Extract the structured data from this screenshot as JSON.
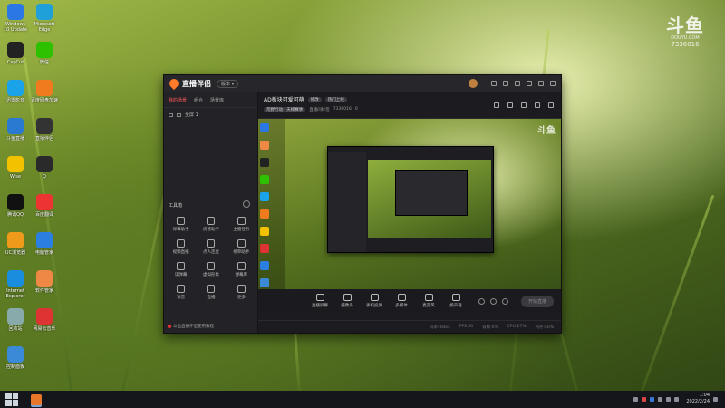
{
  "watermark": {
    "logo": "斗鱼",
    "sub": "DOUYU.COM",
    "room_no": "7336016"
  },
  "desktop_icons": [
    {
      "label": "Windows 10 Update",
      "color": "#2b78e4"
    },
    {
      "label": "Microsoft Edge",
      "color": "#1fa0d8"
    },
    {
      "label": "CapCut",
      "color": "#222"
    },
    {
      "label": "微信",
      "color": "#2dc100"
    },
    {
      "label": "迅雷影音",
      "color": "#1aa3e8"
    },
    {
      "label": "百度网盘加速",
      "color": "#f07b1e"
    },
    {
      "label": "斗鱼直播",
      "color": "#2a7ad1"
    },
    {
      "label": "直播伴侣",
      "color": "#333"
    },
    {
      "label": "Wise",
      "color": "#f2c200"
    },
    {
      "label": "Q",
      "color": "#2a2a2a"
    },
    {
      "label": "腾讯QQ",
      "color": "#111"
    },
    {
      "label": "百度翻译",
      "color": "#e33"
    },
    {
      "label": "UC浏览器",
      "color": "#f09a1c"
    },
    {
      "label": "电脑管家",
      "color": "#2a7fe0"
    },
    {
      "label": "Internet Explorer",
      "color": "#1a8ddf"
    },
    {
      "label": "软件管家",
      "color": "#e84"
    },
    {
      "label": "回收站",
      "color": "#8aa"
    },
    {
      "label": "网易云音乐",
      "color": "#d33"
    },
    {
      "label": "控制面板",
      "color": "#3a8ad8"
    }
  ],
  "app": {
    "brand": "直播伴侣",
    "version": "版本 ▾",
    "left": {
      "tabs": [
        "我的场景",
        "组合",
        "场景库"
      ],
      "scene": "全屏 1",
      "tools_title": "工具箱",
      "tools": [
        "弹幕助手",
        "房管助手",
        "主播任务",
        "视频直播",
        "点人连麦",
        "榜单助手",
        "读弹幕",
        "虚拟形象",
        "弹幕库",
        "语音",
        "直播",
        "更多"
      ],
      "notice": "斗鱼直播伴侣使用教程"
    },
    "main": {
      "room_title": "AD板块可爱可萌",
      "edit_label": "修改",
      "category": "热门上线",
      "meta": [
        "荒野行动 · 天梯赛季",
        "直播间标签",
        "7336016",
        "0"
      ]
    },
    "controls": [
      "直播屏幕",
      "摄像头",
      "手机投屏",
      "多媒体",
      "麦克风",
      "扬声器"
    ],
    "start_label": "开始直播",
    "status": [
      "码率:0kb/s",
      "FPS:30",
      "丢帧:0%",
      "CPU:27%",
      "内存:40%"
    ]
  },
  "taskbar": {
    "time": "1:04",
    "date": "2022/2/24"
  }
}
